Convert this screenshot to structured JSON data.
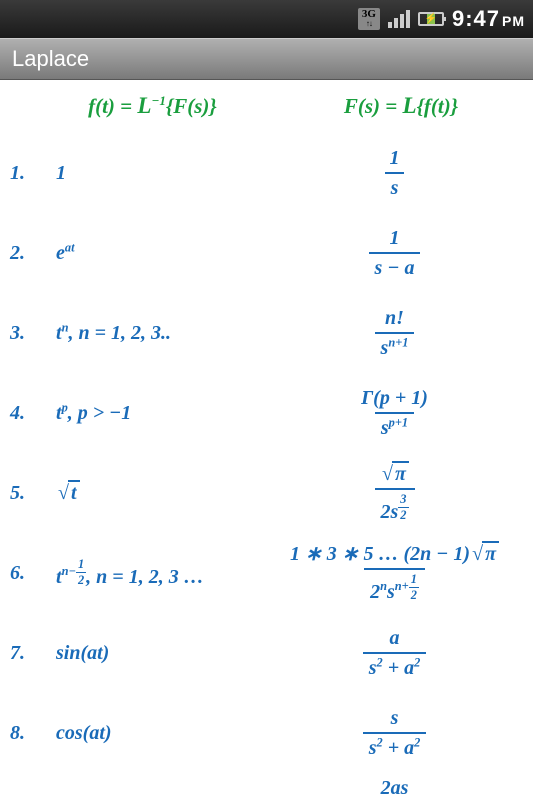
{
  "status_bar": {
    "network_badge": "3G",
    "time": "9:47",
    "ampm": "PM"
  },
  "title_bar": {
    "title": "Laplace"
  },
  "headers": {
    "left_prefix": "f(t) = ",
    "left_l": "L",
    "left_sup": "−1",
    "left_suffix": "{F(s)}",
    "right_prefix": "F(s) = ",
    "right_l": "L",
    "right_suffix": "{f(t)}"
  },
  "rows": [
    {
      "num": "1.",
      "ft_html": "1",
      "fs_frac": {
        "num_html": "1",
        "den_html": "s"
      }
    },
    {
      "num": "2.",
      "ft_html": "e<sup>at</sup>",
      "fs_frac": {
        "num_html": "1",
        "den_html": "s − a"
      }
    },
    {
      "num": "3.",
      "ft_html": "t<sup>n</sup>, n = 1, 2, 3..",
      "fs_frac": {
        "num_html": "n!",
        "den_html": "s<sup>n+1</sup>"
      }
    },
    {
      "num": "4.",
      "ft_html": "t<sup>p</sup>, p > −1",
      "fs_frac": {
        "num_html": "Γ(p + 1)",
        "den_html": "s<sup>p+1</sup>"
      }
    },
    {
      "num": "5.",
      "ft_html": "<span class='sqrt'><span class='radicand'>t</span></span>",
      "fs_frac": {
        "num_html": "<span class='sqrt'><span class='radicand'>π</span></span>",
        "den_html": "2s<sup><span class='frac' style='font-size:1em'><span class='num' style='padding:0 2px'>3</span><span class='den' style='padding:0 2px;border-top-width:1px'>2</span></span></sup>"
      }
    },
    {
      "num": "6.",
      "ft_html": "t<sup>n−<span class='frac' style='font-size:1em'><span class='num' style='padding:0 2px'>1</span><span class='den' style='padding:0 2px;border-top-width:1px'>2</span></span></sup>, n = 1, 2, 3 …",
      "fs_frac": {
        "num_html": "1 ∗ 3 ∗ 5 … (2n − 1)<span class='sqrt'><span class='radicand'>π</span></span>",
        "den_html": "2<sup>n</sup>s<sup>n+<span class='frac' style='font-size:1em'><span class='num' style='padding:0 2px'>1</span><span class='den' style='padding:0 2px;border-top-width:1px'>2</span></span></sup>"
      }
    },
    {
      "num": "7.",
      "ft_html": "sin(at)",
      "fs_frac": {
        "num_html": "a",
        "den_html": "s<sup>2</sup> + a<sup>2</sup>"
      }
    },
    {
      "num": "8.",
      "ft_html": "cos(at)",
      "fs_frac": {
        "num_html": "s",
        "den_html": "s<sup>2</sup> + a<sup>2</sup>"
      }
    }
  ],
  "partial_next": "2as"
}
